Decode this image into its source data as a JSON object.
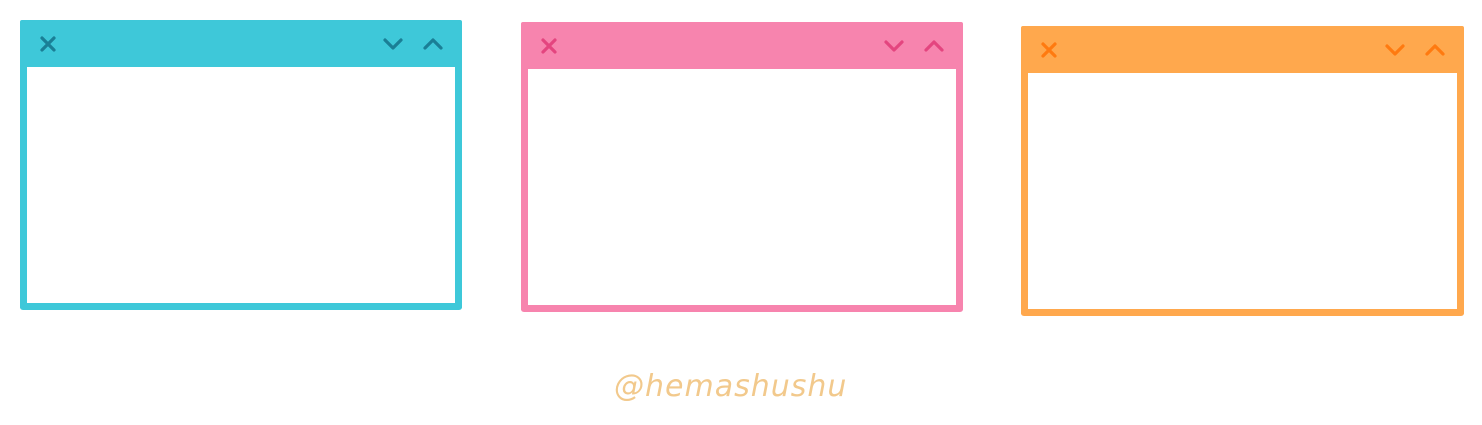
{
  "windows": [
    {
      "name": "window-blue",
      "frame_color": "#3ec8d9",
      "icon_color": "#1a7f96",
      "controls": [
        "close-icon",
        "chevron-down-icon",
        "chevron-up-icon"
      ]
    },
    {
      "name": "window-pink",
      "frame_color": "#f784ae",
      "icon_color": "#e4457f",
      "controls": [
        "close-icon",
        "chevron-down-icon",
        "chevron-up-icon"
      ]
    },
    {
      "name": "window-orange",
      "frame_color": "#ffa84d",
      "icon_color": "#ff7a10",
      "controls": [
        "close-icon",
        "chevron-down-icon",
        "chevron-up-icon"
      ]
    }
  ],
  "signature": {
    "text": "@hemashushu",
    "color": "#f2c98c"
  }
}
